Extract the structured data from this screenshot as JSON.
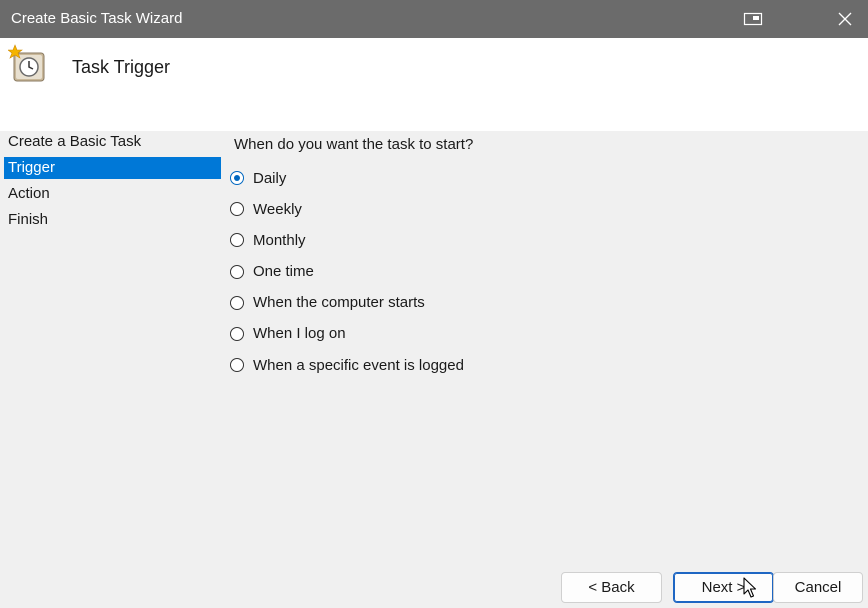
{
  "window": {
    "title": "Create Basic Task Wizard",
    "icons": {
      "snap": "snap-layout-icon",
      "close": "close-icon"
    }
  },
  "header": {
    "title": "Task Trigger",
    "icon": "task-scheduler-clock-icon"
  },
  "nav": {
    "items": [
      {
        "label": "Create a Basic Task",
        "selected": false
      },
      {
        "label": "Trigger",
        "selected": true
      },
      {
        "label": "Action",
        "selected": false
      },
      {
        "label": "Finish",
        "selected": false
      }
    ]
  },
  "main": {
    "question": "When do you want the task to start?",
    "options": [
      {
        "label": "Daily",
        "checked": true
      },
      {
        "label": "Weekly",
        "checked": false
      },
      {
        "label": "Monthly",
        "checked": false
      },
      {
        "label": "One time",
        "checked": false
      },
      {
        "label": "When the computer starts",
        "checked": false
      },
      {
        "label": "When I log on",
        "checked": false
      },
      {
        "label": "When a specific event is logged",
        "checked": false
      }
    ]
  },
  "buttons": {
    "back": "< Back",
    "next": "Next >",
    "cancel": "Cancel"
  },
  "colors": {
    "titlebar": "#6b6b6b",
    "accent": "#0078d7",
    "radio_checked": "#0067c0"
  }
}
